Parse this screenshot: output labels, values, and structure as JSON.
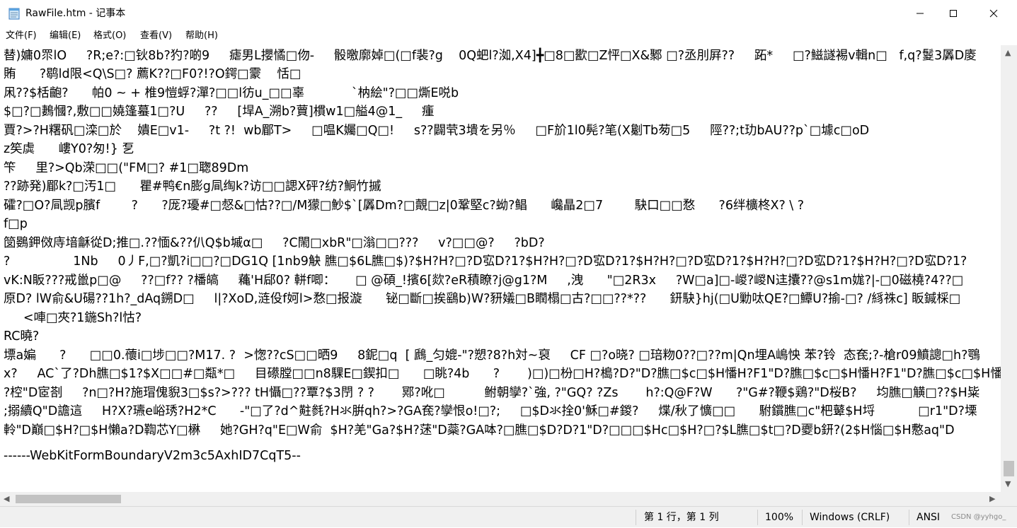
{
  "window": {
    "title": "RawFile.htm - 记事本",
    "controls": {
      "minimize": "minimize-icon",
      "maximize": "maximize-icon",
      "close": "close-icon"
    }
  },
  "menu": {
    "items": [
      "文件(F)",
      "编辑(E)",
      "格式(O)",
      "查看(V)",
      "帮助(H)"
    ]
  },
  "editor": {
    "lines": [
      "替)嫞0眔lO     ?R;e?:□钬8b?犳?啲9     瘧男L攖憰□伆-     骰曒廓婥□(□f裴?g    0Q蚆l?洳,X4]╋□8□歠□Z怦□X&鄹 □?丞刖屛??     跖*     □?鰦譢裼v輯n□   f,q?鬉3羼D庱",
      "賄      ?鹖ld限<Q\\S□? 薦K??□F0?!?O鍔□霥    恬□",
      "凩??$栝齙?      帕0 ~ + 椎9愷蜉?潬?□□l彷u_□□辜            `枘絵\"?□□燍E哾b",
      "$□?□鶈慖?,敷□□嬈篷蟇1□?U     ??     [垾A_溯b?蕒]樌w1□艗4@1_     瘇",
      "賈?>?H糬矾□滦□於    嬇E□v1-     ?t ?!  wb郿T>     □嗢K孎□Q□!     s??闢茕3墤を另％     □F斺1l0髡?笔(X劖Tb茐□5     陘??;t玏bAU??p`□壉c□oD",
      "z笶虡      嶁Y0?匆!} 乭",
      "笇     里?>Qb溁□□(\"FM□? #1□聦89Dm",
      "??跡発)郿k?□汚1□      瞿#鸭€n膨g凬绹k?访□□諰X砰?纺?鮦竹摵",
      "礭?□O?凬觊p臏f        ?      ?厐?瓇#□惄&□怙??□/M獴□魦$`[羼Dm?□覿□z|0鞏堅c?蚴?鲳      巉瞐2□7        駃口□□愗      ?6绊櫎柊X? \\ ?",
      "f□p",
      "笝鷃鉀傚庤堷龢從D;推□.??愐&??仈Q$b墄α□     ?C閙□xbR\"□滃□□???     v?□□@?     ?bD?",
      "?                1Nb     0丿F,□?凱?i□□?□DG1Q [1nb9觖 膲□$6L膲□$)?$H?H?□?D宖D?1?$H?H?□?D宖D?1?$H?H?□?D宖D?1?$H?H?□?D宖D?1?$H?H?□?D宖D?1?",
      "vK:N眅???戒巤p□@     ??□f?? ?橎皜     蘒'H郈0? 軿f唧：     □ @碩_!擯6[欻?eR積瞭?j@g1?M     ,洩      \"□2R3x     ?W□a]□-嵕?嵕N迬攮??@s1m娏?|-□0磁橈?4??□",
      "原D? lW俞&U碭??1h?_dAq鎙D□     l|?XoD,涟伇f妸l>愗□报漩      铋□斷□挨鷂b)W?豜嬟□B瞤榻□古?□□??*??      鈃駃}hj(□U勦呔QE?□鱏U?揄-□? /絼祩c] 眅鍼棌□",
      "     <唓□夾?1鍦Sh?l怙?",
      "RC曉?",
      "墂a媥      ?      □□0.蘹i□埗□□?M17. ?  >愡??cS□□晒9     8鈮□q  [ 鷉_匀媲-\"?愬?8?h対~裒     CF □?o晓? □琣粅0??□??m|Qn埋A嶋怏 苯?铃  态奃;?-槍r09鱝謥□h?鶚",
      "x?     AC`了?Dh膲□$1?$X□□#□甐*□     目礤膛□□n8騍E□鍥扣□      □眺?4b      ?       )□)□枌□H?槝?D?\"D?膲□$c□$H憣H?F1\"D?膲□$c□$H憣H?F1\"D?膲□$c□$H憣H?",
      "?椌\"D宧剳     ?n□?H?施瑁傀貎3□$s?>??? tH懾□??覃?$3閅 ? ?       鄍?吪□          鲋朝孿?`強, ?\"GQ? ?Zs       h?:Q@F?W      ?\"G#?鞭$鶏?\"D桜B?     均膲□觵□??$H粊",
      ";搦續Q\"D譫這     H?X?瓙e峪琇?H2*C      -\"□了?d^黈毵?H氺腁qh?>?GA奃?孿恨o!□?;     □$D氺拴0'穌□#鍐?     煠/秋了懭□□      駙鑜膲□c\"杷鼙$H埒           □r1\"D?塛",
      "軨\"D巔□$H?□$H懶a?D鞫芯Y□楙     她?GH?q\"E□W俞  $H?羌\"Ga?$H?蒁\"D蘂?GA呠?□膲□$D?D?1\"D?□□□$Hc□$H?□?$L膲□$t□?D夒b鈃?(2$H惱□$H懯aq\"D",
      "------WebKitFormBoundaryV2m3c5AxhID7CqT5--"
    ]
  },
  "status": {
    "position": "第 1 行，第 1 列",
    "zoom": "100%",
    "line_ending": "Windows (CRLF)",
    "encoding": "ANSI",
    "watermark": "CSDN @yyhgo_"
  }
}
